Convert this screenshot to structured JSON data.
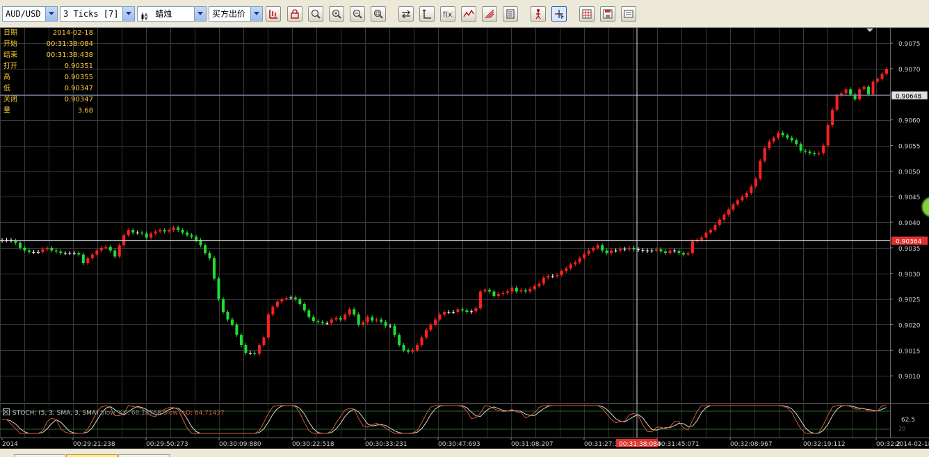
{
  "toolbar": {
    "symbol": "AUD/USD",
    "ticks": "3 Ticks [7]",
    "chart_type": "蜡烛",
    "price_type": "买方出价",
    "buttons": [
      "bars-icon",
      "lock-icon",
      "zoom-fit-icon",
      "zoom-in-icon",
      "zoom-out-icon",
      "zoom-reset-icon",
      "scroll-icon",
      "axis-icon",
      "function-icon",
      "indicator-icon",
      "signal-icon",
      "news-icon",
      "figure-icon",
      "crosshair-icon",
      "grid-icon",
      "save-icon",
      "properties-icon"
    ]
  },
  "info_panel": [
    {
      "label": "日期",
      "value": "2014-02-18"
    },
    {
      "label": "开始",
      "value": "00:31:38:084"
    },
    {
      "label": "结束",
      "value": "00:31:38:438"
    },
    {
      "label": "打开",
      "value": "0.90351"
    },
    {
      "label": "高",
      "value": "0.90355"
    },
    {
      "label": "低",
      "value": "0.90347"
    },
    {
      "label": "关闭",
      "value": "0.90347"
    },
    {
      "label": "量",
      "value": "3.68"
    }
  ],
  "price_axis": {
    "ticks": [
      "0.9075",
      "0.9070",
      "0.9065",
      "0.9060",
      "0.9055",
      "0.9050",
      "0.9045",
      "0.9040",
      "0.9035",
      "0.9030",
      "0.9025",
      "0.9020",
      "0.9015",
      "0.9010"
    ],
    "hline_label": "0.90648",
    "cursor_label": "0.90364"
  },
  "stoch": {
    "legend_main": "STOCH: (5, 3, SMA, 3, SMA)",
    "legend_k": "Slow %K: 68.18768",
    "legend_d": "Slow %D: 64.71437",
    "level_label": "62.5",
    "low_label": "20"
  },
  "time_axis": {
    "labels": [
      "2014",
      "00:29:21:238",
      "00:29:50:273",
      "00:30:09:880",
      "00:30:22:518",
      "00:30:33:231",
      "00:30:47:693",
      "00:31:08:207",
      "00:31:27:3",
      "00:31:45:071",
      "00:32:08:967",
      "00:32:19:112",
      "00:32:2"
    ],
    "cursor_label": "00:31:38:084",
    "end_label": "2014-02-18"
  },
  "chart_data": {
    "type": "candlestick",
    "y_range": [
      0.9005,
      0.9078
    ],
    "closes": [
      0.90365,
      0.90365,
      0.90364,
      0.9036,
      0.9035,
      0.90345,
      0.90342,
      0.90342,
      0.90342,
      0.90347,
      0.9035,
      0.90345,
      0.90343,
      0.9034,
      0.9034,
      0.9034,
      0.9034,
      0.90337,
      0.9032,
      0.9033,
      0.90337,
      0.90345,
      0.9035,
      0.90352,
      0.90345,
      0.90333,
      0.90355,
      0.90375,
      0.90385,
      0.9038,
      0.9038,
      0.90378,
      0.9037,
      0.90378,
      0.90382,
      0.90385,
      0.90382,
      0.90385,
      0.9039,
      0.90385,
      0.9038,
      0.90375,
      0.90372,
      0.90365,
      0.90355,
      0.9034,
      0.9033,
      0.9029,
      0.9025,
      0.90225,
      0.9021,
      0.902,
      0.9018,
      0.9016,
      0.90145,
      0.90145,
      0.90143,
      0.9016,
      0.90175,
      0.9022,
      0.90235,
      0.90245,
      0.9025,
      0.90252,
      0.90253,
      0.9025,
      0.9024,
      0.90228,
      0.90215,
      0.90207,
      0.90205,
      0.90203,
      0.90203,
      0.9021,
      0.90213,
      0.9021,
      0.9022,
      0.9023,
      0.9022,
      0.902,
      0.90205,
      0.90215,
      0.90208,
      0.9021,
      0.90205,
      0.90198,
      0.90198,
      0.9018,
      0.9016,
      0.9015,
      0.90147,
      0.9015,
      0.9016,
      0.90175,
      0.9019,
      0.902,
      0.9021,
      0.9022,
      0.90225,
      0.90225,
      0.90225,
      0.9023,
      0.90228,
      0.90225,
      0.90226,
      0.90232,
      0.90265,
      0.90268,
      0.90265,
      0.90256,
      0.9026,
      0.90262,
      0.90265,
      0.90272,
      0.90265,
      0.90267,
      0.90265,
      0.9027,
      0.90275,
      0.9028,
      0.90292,
      0.90295,
      0.90295,
      0.90297,
      0.90305,
      0.9031,
      0.90318,
      0.90322,
      0.9033,
      0.90338,
      0.90345,
      0.9035,
      0.90355,
      0.90345,
      0.9034,
      0.90345,
      0.90345,
      0.90348,
      0.90347,
      0.9035,
      0.90347,
      0.90346,
      0.90345,
      0.90344,
      0.90345,
      0.90347,
      0.90343,
      0.9034,
      0.90345,
      0.90344,
      0.9034,
      0.90337,
      0.9034,
      0.90363,
      0.90366,
      0.9037,
      0.9038,
      0.90385,
      0.90395,
      0.90405,
      0.90415,
      0.90425,
      0.90435,
      0.90443,
      0.9045,
      0.90457,
      0.9047,
      0.90485,
      0.9052,
      0.90545,
      0.90558,
      0.90565,
      0.90575,
      0.9057,
      0.90565,
      0.9056,
      0.90553,
      0.9054,
      0.90538,
      0.90535,
      0.90533,
      0.90535,
      0.9055,
      0.9059,
      0.9062,
      0.90648,
      0.90652,
      0.9066,
      0.9065,
      0.9064,
      0.9066,
      0.90665,
      0.9065,
      0.90675,
      0.9068,
      0.9069,
      0.907
    ]
  }
}
